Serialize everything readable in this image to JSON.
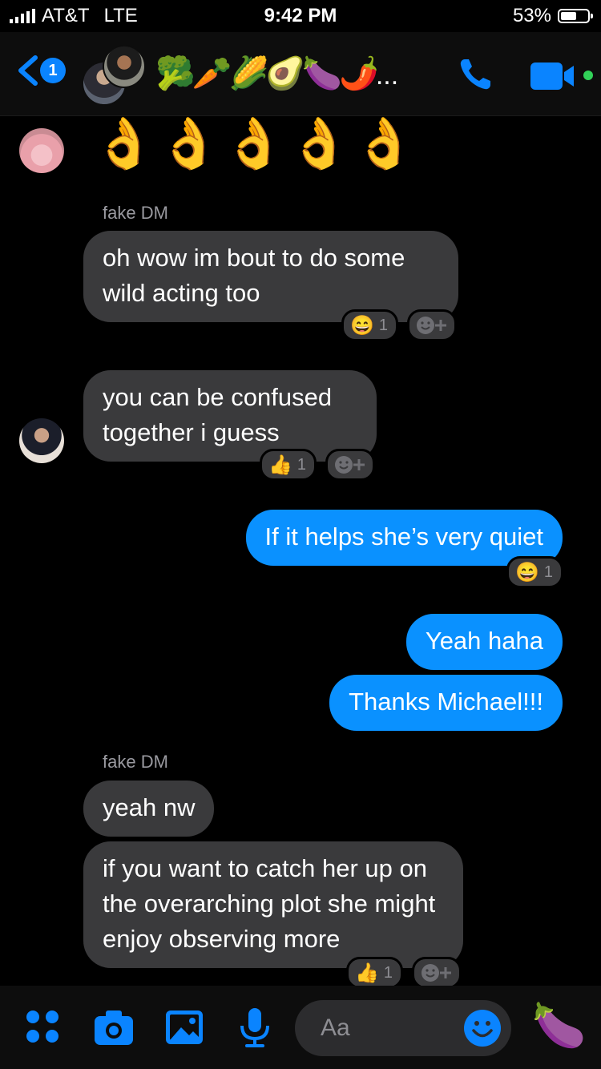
{
  "status": {
    "carrier": "AT&T",
    "network": "LTE",
    "time": "9:42 PM",
    "battery": "53%",
    "battery_level": 0.53
  },
  "header": {
    "unread_count": "1",
    "title_emojis": "🥦🥕🌽🥑🍆🌶️",
    "title_more": "...",
    "accent_color": "#0a84ff",
    "active_color": "#31d158"
  },
  "messages": {
    "ok_hands": "👌👌👌👌👌",
    "m1": {
      "sender": "fake DM",
      "text": "oh wow im bout to do some wild acting too",
      "reaction": "😄",
      "count": "1"
    },
    "m2": {
      "text": "you can be confused together i guess",
      "reaction": "👍",
      "count": "1"
    },
    "m3": {
      "text": "If it helps she’s very quiet",
      "reaction": "😄",
      "count": "1"
    },
    "m4": {
      "text": "Yeah haha"
    },
    "m5": {
      "text": "Thanks Michael!!!"
    },
    "m6": {
      "sender": "fake DM",
      "text": "yeah nw"
    },
    "m7": {
      "text": "if you want to catch her up on the overarching plot she might enjoy observing more",
      "reaction": "👍",
      "count": "1"
    }
  },
  "composer": {
    "placeholder": "Aa",
    "send_emoji": "🍆"
  }
}
